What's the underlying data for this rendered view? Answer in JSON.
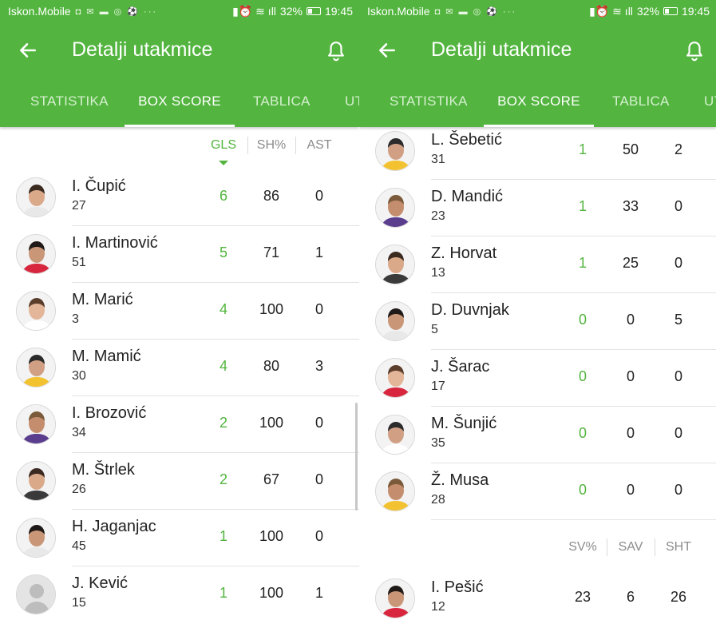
{
  "status_bar": {
    "carrier": "Iskon.Mobile",
    "battery": "32%",
    "time": "19:45"
  },
  "header": {
    "title": "Detalji utakmice",
    "back_icon": "arrow-left-icon",
    "bell_icon": "bell-icon"
  },
  "tabs": [
    "STATISTIKA",
    "BOX SCORE",
    "TABLICA",
    "UT"
  ],
  "active_tab": "BOX SCORE",
  "colors": {
    "accent": "#53b53f",
    "header_bg": "#53b53f"
  },
  "left": {
    "columns": [
      "GLS",
      "SH%",
      "AST"
    ],
    "sorted_column": "GLS",
    "rows": [
      {
        "name": "I. Čupić",
        "number": "27",
        "gls": "6",
        "sh": "86",
        "ast": "0"
      },
      {
        "name": "I. Martinović",
        "number": "51",
        "gls": "5",
        "sh": "71",
        "ast": "1"
      },
      {
        "name": "M. Marić",
        "number": "3",
        "gls": "4",
        "sh": "100",
        "ast": "0"
      },
      {
        "name": "M. Mamić",
        "number": "30",
        "gls": "4",
        "sh": "80",
        "ast": "3"
      },
      {
        "name": "I. Brozović",
        "number": "34",
        "gls": "2",
        "sh": "100",
        "ast": "0"
      },
      {
        "name": "M. Štrlek",
        "number": "26",
        "gls": "2",
        "sh": "67",
        "ast": "0"
      },
      {
        "name": "H. Jaganjac",
        "number": "45",
        "gls": "1",
        "sh": "100",
        "ast": "0"
      },
      {
        "name": "J. Kević",
        "number": "15",
        "gls": "1",
        "sh": "100",
        "ast": "1"
      }
    ]
  },
  "right": {
    "rows": [
      {
        "name": "L. Šebetić",
        "number": "31",
        "gls": "1",
        "sh": "50",
        "ast": "2"
      },
      {
        "name": "D. Mandić",
        "number": "23",
        "gls": "1",
        "sh": "33",
        "ast": "0"
      },
      {
        "name": "Z. Horvat",
        "number": "13",
        "gls": "1",
        "sh": "25",
        "ast": "0"
      },
      {
        "name": "D. Duvnjak",
        "number": "5",
        "gls": "0",
        "sh": "0",
        "ast": "5"
      },
      {
        "name": "J. Šarac",
        "number": "17",
        "gls": "0",
        "sh": "0",
        "ast": "0"
      },
      {
        "name": "M. Šunjić",
        "number": "35",
        "gls": "0",
        "sh": "0",
        "ast": "0"
      },
      {
        "name": "Ž. Musa",
        "number": "28",
        "gls": "0",
        "sh": "0",
        "ast": "0"
      }
    ],
    "goalkeeper_columns": [
      "SV%",
      "SAV",
      "SHT"
    ],
    "goalkeepers": [
      {
        "name": "I. Pešić",
        "number": "12",
        "sv": "23",
        "sav": "6",
        "sht": "26"
      }
    ]
  }
}
